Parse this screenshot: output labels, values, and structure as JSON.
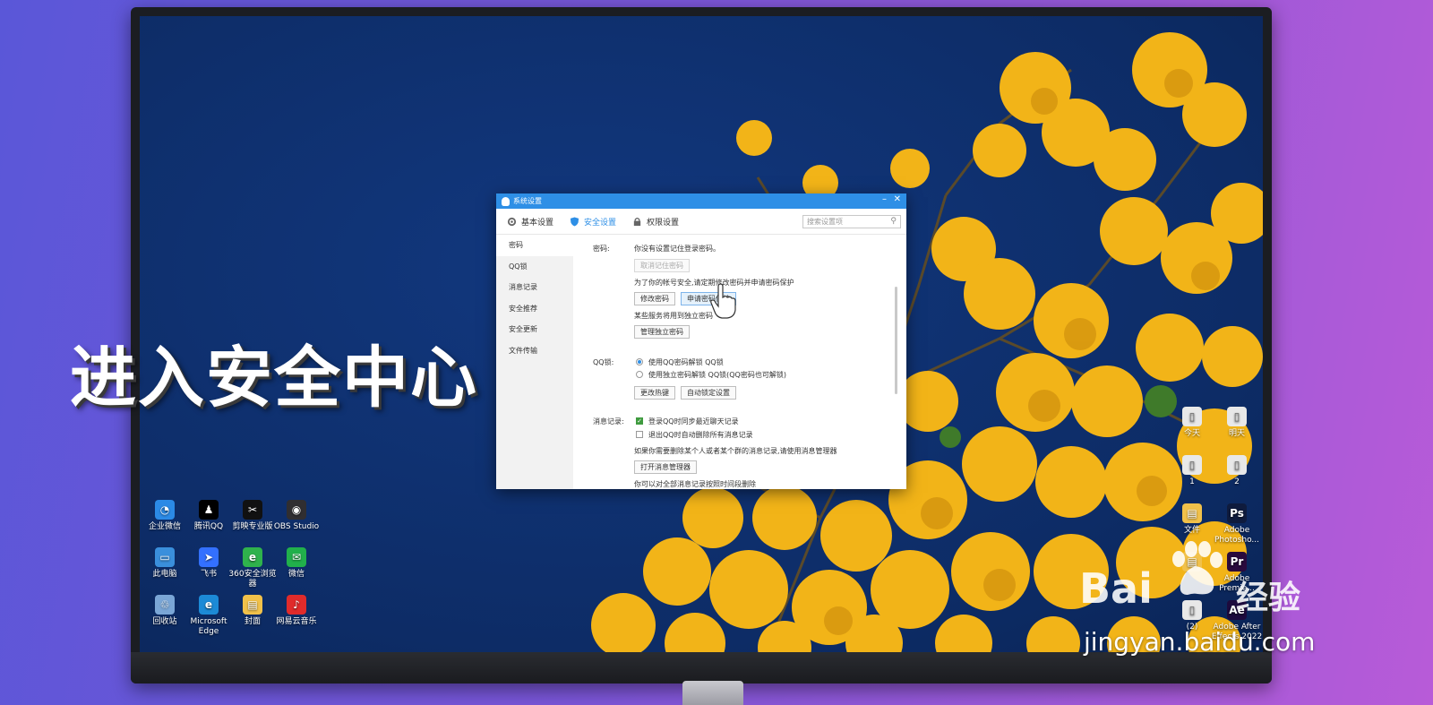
{
  "overlay_title": "进入安全中心",
  "watermark": {
    "logo_prefix": "Bai",
    "logo_suffix": "经验",
    "url": "jingyan.baidu.com"
  },
  "desktop_left_icons": [
    {
      "label": "企业微信",
      "icon": "wecom-icon",
      "color": "#2b8ae6"
    },
    {
      "label": "腾讯QQ",
      "icon": "qq-penguin-icon",
      "color": "#000000"
    },
    {
      "label": "剪映专业版",
      "icon": "capcut-icon",
      "color": "#111111"
    },
    {
      "label": "OBS Studio",
      "icon": "obs-icon",
      "color": "#302e31"
    },
    {
      "label": "此电脑",
      "icon": "computer-icon",
      "color": "#3a8fdc"
    },
    {
      "label": "飞书",
      "icon": "feishu-icon",
      "color": "#3370ff"
    },
    {
      "label": "360安全浏览器",
      "icon": "360-browser-icon",
      "color": "#2fb24c"
    },
    {
      "label": "微信",
      "icon": "wechat-icon",
      "color": "#21b04b"
    },
    {
      "label": "回收站",
      "icon": "recycle-bin-icon",
      "color": "#7aa6d6"
    },
    {
      "label": "Microsoft Edge",
      "icon": "edge-icon",
      "color": "#1c8ad6"
    },
    {
      "label": "封面",
      "icon": "folder-icon",
      "color": "#f1c14a"
    },
    {
      "label": "网易云音乐",
      "icon": "netease-music-icon",
      "color": "#e02b2b"
    }
  ],
  "desktop_right_icons": [
    {
      "label": "今天",
      "icon": "file-icon",
      "color": "#e8e8e8"
    },
    {
      "label": "明天",
      "icon": "file-icon",
      "color": "#e8e8e8"
    },
    {
      "label": "1",
      "icon": "file-icon",
      "color": "#e8e8e8"
    },
    {
      "label": "2",
      "icon": "file-icon",
      "color": "#e8e8e8"
    },
    {
      "label": "文件",
      "icon": "folder-icon",
      "color": "#f1c14a"
    },
    {
      "label": "Adobe Photosho...",
      "icon": "photoshop-icon",
      "color": "#0f1b3d"
    },
    {
      "label": "",
      "icon": "folder-icon",
      "color": "#f1c14a"
    },
    {
      "label": "Adobe Premie...",
      "icon": "premiere-icon",
      "color": "#2a0a3d"
    },
    {
      "label": "(2)",
      "icon": "file-icon",
      "color": "#e8e8e8"
    },
    {
      "label": "Adobe After Effects 2022",
      "icon": "after-effects-icon",
      "color": "#1d0a3d"
    }
  ],
  "dialog": {
    "title": "系统设置",
    "tabs": [
      {
        "label": "基本设置",
        "icon": "gear-icon"
      },
      {
        "label": "安全设置",
        "icon": "shield-icon"
      },
      {
        "label": "权限设置",
        "icon": "lock-icon"
      }
    ],
    "search_placeholder": "搜索设置项",
    "nav": [
      "密码",
      "QQ锁",
      "消息记录",
      "安全推荐",
      "安全更新",
      "文件传输"
    ],
    "password": {
      "label": "密码:",
      "status": "你没有设置记住登录密码。",
      "cancel_remember": "取消记住密码",
      "tip": "为了你的帐号安全,请定期修改密码并申请密码保护",
      "change_password": "修改密码",
      "apply_protection": "申请密码保护",
      "independent_tip": "某些服务将用到独立密码",
      "manage_independent": "管理独立密码"
    },
    "qq_lock": {
      "label": "QQ锁:",
      "option1": "使用QQ密码解锁 QQ锁",
      "option2": "使用独立密码解锁 QQ锁(QQ密码也可解锁)",
      "change_hotkey": "更改热键",
      "auto_lock": "自动锁定设置"
    },
    "messages": {
      "label": "消息记录:",
      "sync": "登录QQ时同步最近聊天记录",
      "delete_on_exit": "退出QQ时自动删除所有消息记录",
      "manager_tip": "如果你需要删除某个人或者某个群的消息记录,请使用消息管理器",
      "open_manager": "打开消息管理器",
      "time_delete_tip": "你可以对全部消息记录按照时间段删除"
    }
  },
  "colors": {
    "accent": "#2e8fe6",
    "desktop_bg": "#0d2c66",
    "flower": "#f2b418"
  }
}
